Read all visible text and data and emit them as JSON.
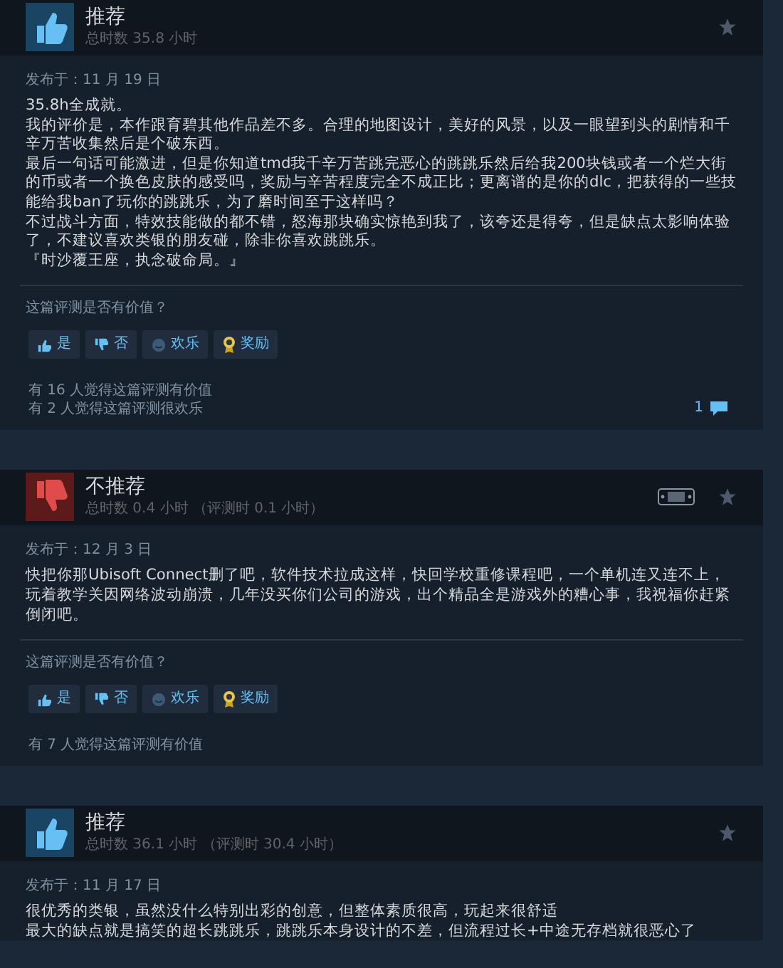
{
  "reviews": [
    {
      "recommended": true,
      "title": "推荐",
      "playtime": "总时数 35.8 小时",
      "has_deck": false,
      "posted": "发布于：11 月 19 日",
      "paragraphs": [
        "35.8h全成就。",
        "我的评价是，本作跟育碧其他作品差不多。合理的地图设计，美好的风景，以及一眼望到头的剧情和千辛万苦收集然后是个破东西。",
        "最后一句话可能激进，但是你知道tmd我千辛万苦跳完恶心的跳跳乐然后给我200块钱或者一个烂大街的币或者一个换色皮肤的感受吗，奖励与辛苦程度完全不成正比；更离谱的是你的dlc，把获得的一些技能给我ban了玩你的跳跳乐，为了磨时间至于这样吗？",
        "不过战斗方面，特效技能做的都不错，怒海那块确实惊艳到我了，该夸还是得夸，但是缺点太影响体验了，不建议喜欢类银的朋友碰，除非你喜欢跳跳乐。",
        "『时沙覆王座，执念破命局。』"
      ],
      "helpful_prompt": "这篇评测是否有价值？",
      "buttons": [
        {
          "kind": "yes",
          "label": "是"
        },
        {
          "kind": "no",
          "label": "否"
        },
        {
          "kind": "funny",
          "label": "欢乐"
        },
        {
          "kind": "award",
          "label": "奖励"
        }
      ],
      "stats": [
        "有 16 人觉得这篇评测有价值",
        "有 2 人觉得这篇评测很欢乐"
      ],
      "comments": "1"
    },
    {
      "recommended": false,
      "title": "不推荐",
      "playtime": "总时数 0.4 小时  （评测时 0.1 小时）",
      "has_deck": true,
      "posted": "发布于：12 月 3 日",
      "paragraphs": [
        "快把你那Ubisoft Connect删了吧，软件技术拉成这样，快回学校重修课程吧，一个单机连又连不上，玩着教学关因网络波动崩溃，几年没买你们公司的游戏，出个精品全是游戏外的糟心事，我祝福你赶紧倒闭吧。"
      ],
      "helpful_prompt": "这篇评测是否有价值？",
      "buttons": [
        {
          "kind": "yes",
          "label": "是"
        },
        {
          "kind": "no",
          "label": "否"
        },
        {
          "kind": "funny",
          "label": "欢乐"
        },
        {
          "kind": "award",
          "label": "奖励"
        }
      ],
      "stats": [
        "有 7 人觉得这篇评测有价值"
      ]
    },
    {
      "recommended": true,
      "title": "推荐",
      "playtime": "总时数 36.1 小时  （评测时 30.4 小时）",
      "has_deck": false,
      "posted": "发布于：11 月 17 日",
      "paragraphs": [
        "很优秀的类银，虽然没什么特别出彩的创意，但整体素质很高，玩起来很舒适",
        "最大的缺点就是搞笑的超长跳跳乐，跳跳乐本身设计的不差，但流程过长+中途无存档就很恶心了"
      ]
    }
  ]
}
